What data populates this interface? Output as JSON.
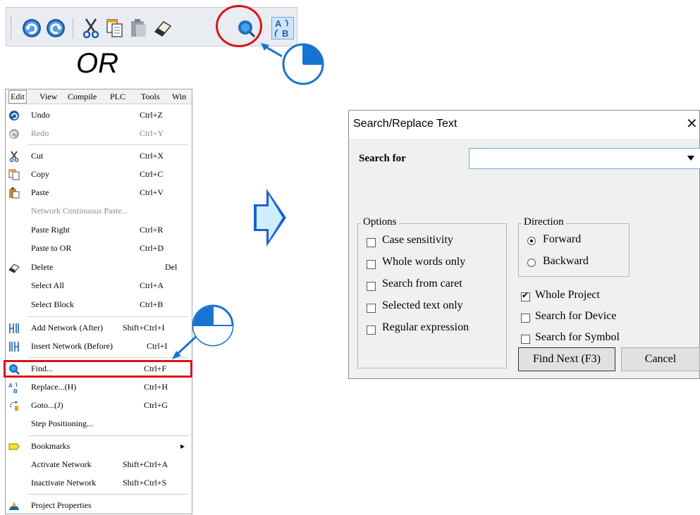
{
  "or_text": "OR",
  "toolbar": {
    "buttons": [
      "undo-icon",
      "redo-icon",
      "cut-icon",
      "copy-icon",
      "paste-icon",
      "delete-icon",
      "find-icon",
      "replace-icon"
    ]
  },
  "menubar": {
    "items": [
      "Edit",
      "View",
      "Compile",
      "PLC",
      "Tools",
      "Win"
    ]
  },
  "menu": {
    "items": [
      {
        "label": "Undo",
        "shortcut": "Ctrl+Z"
      },
      {
        "label": "Redo",
        "shortcut": "Ctrl+Y"
      },
      {
        "label": "Cut",
        "shortcut": "Ctrl+X"
      },
      {
        "label": "Copy",
        "shortcut": "Ctrl+C"
      },
      {
        "label": "Paste",
        "shortcut": "Ctrl+V"
      },
      {
        "label": "Network Continuous Paste...",
        "shortcut": ""
      },
      {
        "label": "Paste Right",
        "shortcut": "Ctrl+R"
      },
      {
        "label": "Paste to OR",
        "shortcut": "Ctrl+D"
      },
      {
        "label": "Delete",
        "shortcut": "Del"
      },
      {
        "label": "Select All",
        "shortcut": "Ctrl+A"
      },
      {
        "label": "Select Block",
        "shortcut": "Ctrl+B"
      },
      {
        "label": "Add Network (After)",
        "shortcut": "Shift+Ctrl+I"
      },
      {
        "label": "Insert Network (Before)",
        "shortcut": "Ctrl+I"
      },
      {
        "label": "Find...",
        "shortcut": "Ctrl+F"
      },
      {
        "label": "Replace...(H)",
        "shortcut": "Ctrl+H"
      },
      {
        "label": "Goto...(J)",
        "shortcut": "Ctrl+G"
      },
      {
        "label": "Step Positioning...",
        "shortcut": ""
      },
      {
        "label": "Bookmarks",
        "shortcut": "▸"
      },
      {
        "label": "Activate Network",
        "shortcut": "Shift+Ctrl+A"
      },
      {
        "label": "Inactivate Network",
        "shortcut": "Shift+Ctrl+S"
      },
      {
        "label": "Project Properties",
        "shortcut": ""
      }
    ]
  },
  "dialog": {
    "title": "Search/Replace Text",
    "close": "✕",
    "search_label": "Search for",
    "search_value": "",
    "options_title": "Options",
    "options": [
      {
        "label": "Case sensitivity",
        "checked": false
      },
      {
        "label": "Whole words only",
        "checked": false
      },
      {
        "label": "Search from caret",
        "checked": false
      },
      {
        "label": "Selected text only",
        "checked": false
      },
      {
        "label": "Regular expression",
        "checked": false
      }
    ],
    "direction_title": "Direction",
    "directions": [
      {
        "label": "Forward",
        "selected": true
      },
      {
        "label": "Backward",
        "selected": false
      }
    ],
    "scope": [
      {
        "label": "Whole Project",
        "checked": true
      },
      {
        "label": "Search for Device",
        "checked": false
      },
      {
        "label": "Search for Symbol",
        "checked": false
      }
    ],
    "find_next_label": "Find Next (F3)",
    "cancel_label": "Cancel"
  },
  "colors": {
    "highlight_red": "#d9141a",
    "step_blue": "#1874d2",
    "arrow_fill": "#cfeeff"
  }
}
